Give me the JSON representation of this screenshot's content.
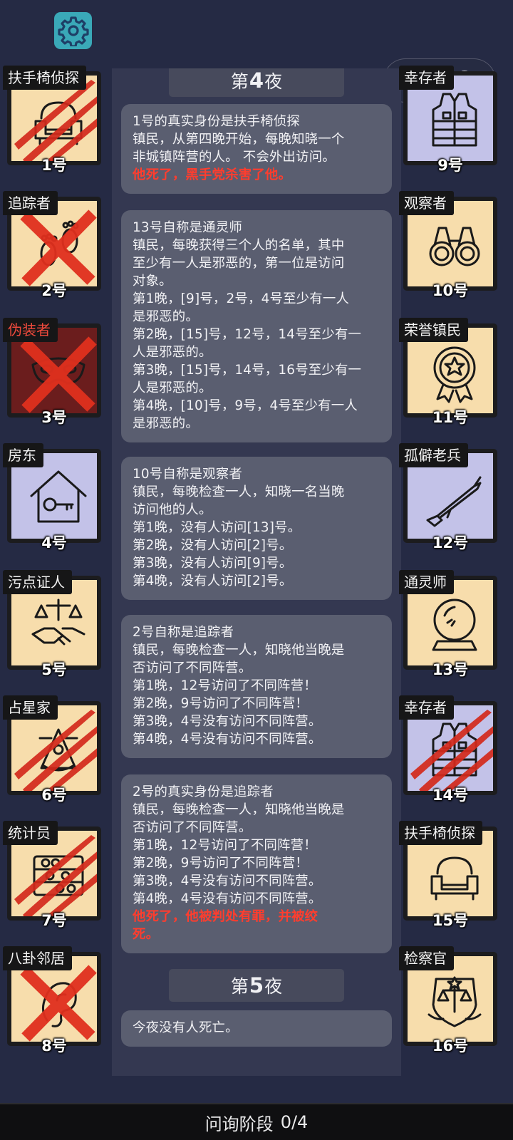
{
  "top": {
    "settings_icon": "gear-icon",
    "menu_icon": "more-dots-icon",
    "close_icon": "target-circle-icon"
  },
  "feed": {
    "night4": {
      "prefix": "第",
      "number": "4",
      "suffix": "夜"
    },
    "night5": {
      "prefix": "第",
      "number": "5",
      "suffix": "夜"
    },
    "messages": [
      {
        "lines": [
          "1号的真实身份是扶手椅侦探",
          "镇民，从第四晚开始，每晚知晓一个",
          "非城镇阵营的人。 不会外出访问。"
        ],
        "red": [
          "他死了，黑手党杀害了他。"
        ]
      },
      {
        "lines": [
          "13号自称是通灵师",
          "镇民，每晚获得三个人的名单，其中",
          "至少有一人是邪恶的，第一位是访问",
          "对象。",
          "第1晚，[9]号，2号，4号至少有一人",
          "是邪恶的。",
          "第2晚，[15]号，12号，14号至少有一",
          "人是邪恶的。",
          "第3晚，[15]号，14号，16号至少有一",
          "人是邪恶的。",
          "第4晚，[10]号，9号，4号至少有一人",
          "是邪恶的。"
        ],
        "red": []
      },
      {
        "lines": [
          "10号自称是观察者",
          "镇民，每晚检查一人，知晓一名当晚",
          "访问他的人。",
          "第1晚，没有人访问[13]号。",
          "第2晚，没有人访问[2]号。",
          "第3晚，没有人访问[9]号。",
          "第4晚，没有人访问[2]号。"
        ],
        "red": []
      },
      {
        "lines": [
          "2号自称是追踪者",
          "镇民，每晚检查一人，知晓他当晚是",
          "否访问了不同阵营。",
          "第1晚，12号访问了不同阵营！",
          "第2晚，9号访问了不同阵营！",
          "第3晚，4号没有访问不同阵营。",
          "第4晚，4号没有访问不同阵营。"
        ],
        "red": []
      },
      {
        "lines": [
          "2号的真实身份是追踪者",
          "镇民，每晚检查一人，知晓他当晚是",
          "否访问了不同阵营。",
          "第1晚，12号访问了不同阵营！",
          "第2晚，9号访问了不同阵营！",
          "第3晚，4号没有访问不同阵营。",
          "第4晚，4号没有访问不同阵营。"
        ],
        "red": [
          "他死了，他被判处有罪，并被绞",
          "死。"
        ]
      },
      {
        "lines": [
          "今夜没有人死亡。"
        ],
        "red": []
      }
    ]
  },
  "players": [
    {
      "role": "扶手椅侦探",
      "number": "1号",
      "icon": "armchair-icon",
      "state": "claw-marks",
      "bg": "#f7ddac"
    },
    {
      "role": "追踪者",
      "number": "2号",
      "icon": "footprints-icon",
      "state": "x-mark",
      "bg": "#f7ddac"
    },
    {
      "role": "伪装者",
      "number": "3号",
      "icon": "mask-icon",
      "state": "x-mark",
      "bg": "#6b1d1d",
      "role_red": true
    },
    {
      "role": "房东",
      "number": "4号",
      "icon": "house-key-icon",
      "state": "alive",
      "bg": "#c3c2e8"
    },
    {
      "role": "污点证人",
      "number": "5号",
      "icon": "handshake-scales-icon",
      "state": "alive",
      "bg": "#f7ddac"
    },
    {
      "role": "占星家",
      "number": "6号",
      "icon": "sextant-icon",
      "state": "claw-marks",
      "bg": "#f7ddac"
    },
    {
      "role": "统计员",
      "number": "7号",
      "icon": "abacus-icon",
      "state": "claw-marks",
      "bg": "#f7ddac"
    },
    {
      "role": "八卦邻居",
      "number": "8号",
      "icon": "ear-icon",
      "state": "x-mark",
      "bg": "#f7ddac"
    },
    {
      "role": "幸存者",
      "number": "9号",
      "icon": "vest-icon",
      "state": "alive",
      "bg": "#c3c2e8"
    },
    {
      "role": "观察者",
      "number": "10号",
      "icon": "binoculars-icon",
      "state": "alive",
      "bg": "#f7ddac"
    },
    {
      "role": "荣誉镇民",
      "number": "11号",
      "icon": "medal-icon",
      "state": "alive",
      "bg": "#f7ddac"
    },
    {
      "role": "孤僻老兵",
      "number": "12号",
      "icon": "rifle-icon",
      "state": "alive",
      "bg": "#c3c2e8"
    },
    {
      "role": "通灵师",
      "number": "13号",
      "icon": "crystal-ball-icon",
      "state": "alive",
      "bg": "#f7ddac"
    },
    {
      "role": "幸存者",
      "number": "14号",
      "icon": "vest-icon",
      "state": "claw-marks",
      "bg": "#c3c2e8"
    },
    {
      "role": "扶手椅侦探",
      "number": "15号",
      "icon": "armchair-icon",
      "state": "alive",
      "bg": "#f7ddac"
    },
    {
      "role": "检察官",
      "number": "16号",
      "icon": "badge-scales-icon",
      "state": "alive",
      "bg": "#f7ddac"
    }
  ],
  "bottom": {
    "stage_label": "问询阶段",
    "progress": "0/4"
  }
}
